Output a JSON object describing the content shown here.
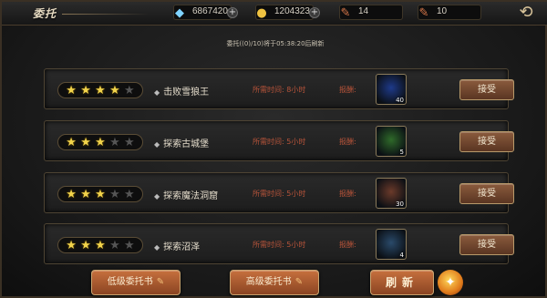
{
  "header": {
    "title": "委托",
    "diamonds": "6867420",
    "gold": "1204323",
    "resource3": "14",
    "resource4": "10",
    "plus_label": "+",
    "back_label": "⟲"
  },
  "notice": "委托((0)/10)将于05:38:20后刷新",
  "quests": [
    {
      "stars": 4,
      "max_stars": 5,
      "name": "击败雪狼王",
      "time": "所需时间: 8小时",
      "reward_label": "报酬:",
      "reward_count": "40",
      "reward_color": "#1e3a8a",
      "accept": "接受"
    },
    {
      "stars": 3,
      "max_stars": 5,
      "name": "探索古城堡",
      "time": "所需时间: 5小时",
      "reward_label": "报酬:",
      "reward_count": "5",
      "reward_color": "#2f6a2a",
      "accept": "接受"
    },
    {
      "stars": 3,
      "max_stars": 5,
      "name": "探索魔法洞窟",
      "time": "所需时间: 5小时",
      "reward_label": "报酬:",
      "reward_count": "30",
      "reward_color": "#6b3a2a",
      "accept": "接受"
    },
    {
      "stars": 3,
      "max_stars": 5,
      "name": "探索沼泽",
      "time": "所需时间: 5小时",
      "reward_label": "报酬:",
      "reward_count": "4",
      "reward_color": "#2a4a6a",
      "accept": "接受"
    }
  ],
  "bottom": {
    "low_book": "低级委托书",
    "high_book": "高级委托书",
    "refresh": "刷新"
  },
  "colors": {
    "accent": "#c6703e",
    "time_text": "#b8543a",
    "star": "#f1d34b"
  }
}
